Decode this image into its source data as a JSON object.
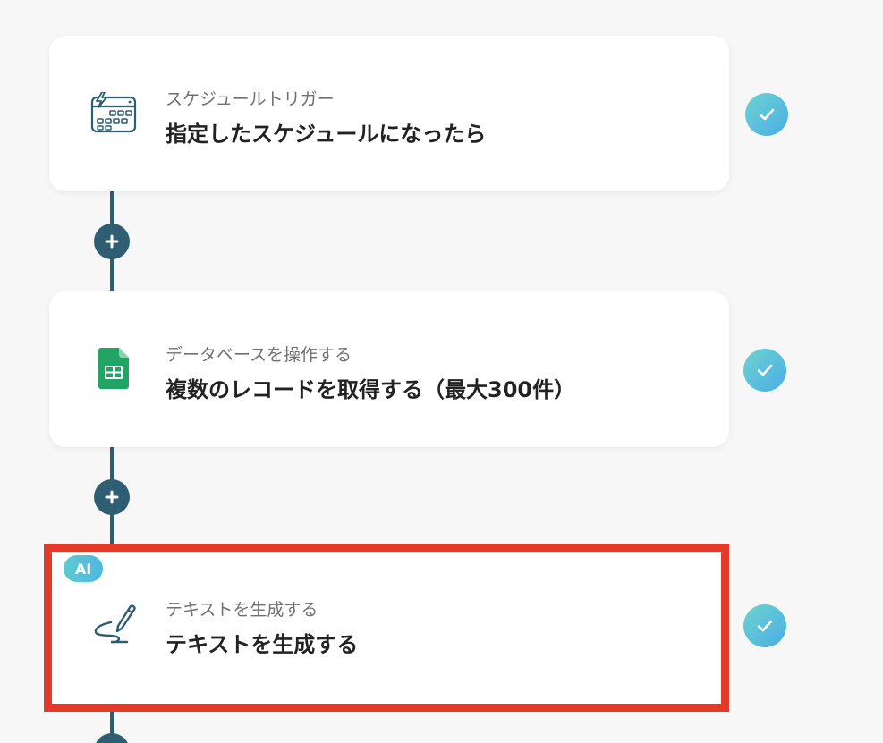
{
  "steps": [
    {
      "subtitle": "スケジュールトリガー",
      "title": "指定したスケジュールになったら",
      "icon": "schedule-trigger-icon",
      "status": "completed"
    },
    {
      "subtitle": "データベースを操作する",
      "title": "複数のレコードを取得する（最大300件）",
      "icon": "google-sheets-icon",
      "status": "completed"
    },
    {
      "subtitle": "テキストを生成する",
      "title": "テキストを生成する",
      "icon": "pen-icon",
      "badge": "AI",
      "status": "completed",
      "highlighted": true
    }
  ],
  "colors": {
    "connector": "#2f5e73",
    "highlight_border": "#e23b2a",
    "check_gradient_start": "#6ed3cf",
    "check_gradient_end": "#4aaee6",
    "background": "#f7f7f7"
  }
}
